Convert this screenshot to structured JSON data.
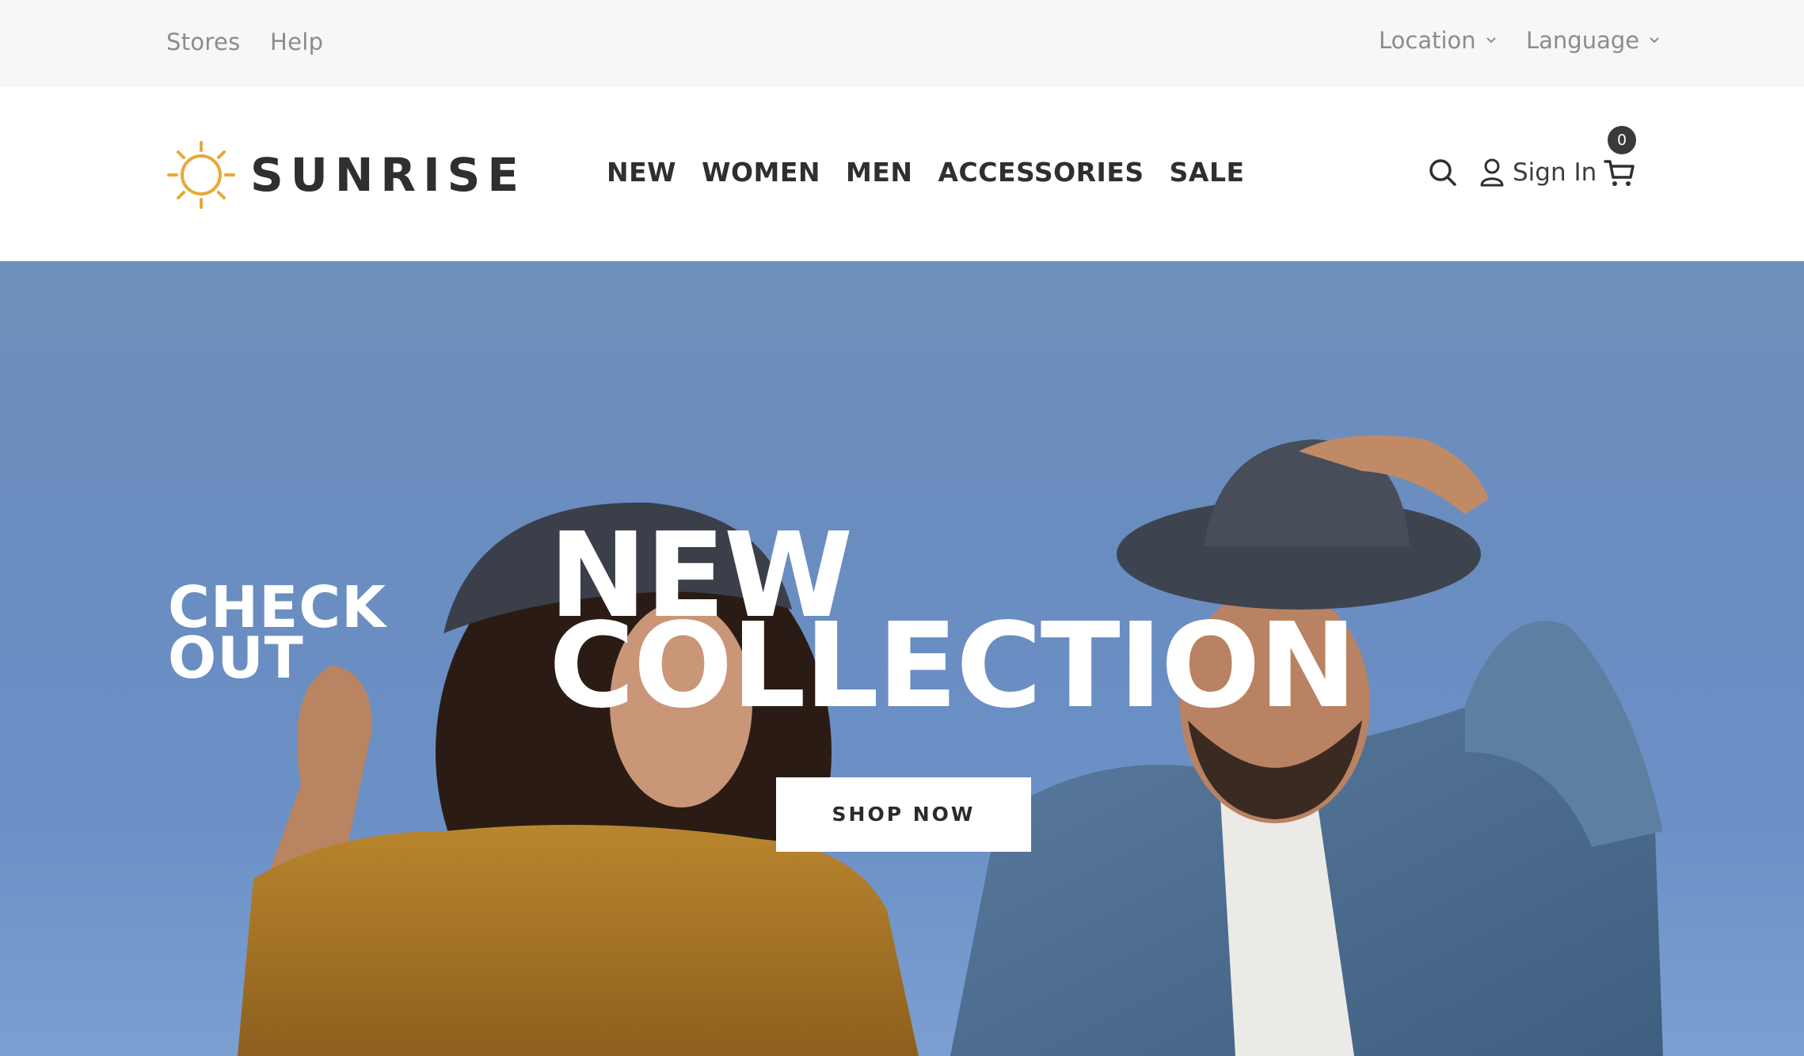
{
  "utility_bar": {
    "links": [
      "Stores",
      "Help"
    ],
    "location_label": "Location",
    "language_label": "Language"
  },
  "header": {
    "brand": "SUNRISE",
    "brand_color": "#e8a83a",
    "nav": [
      "NEW",
      "WOMEN",
      "MEN",
      "ACCESSORIES",
      "SALE"
    ],
    "sign_in_label": "Sign In",
    "cart_count": "0",
    "icons": [
      "search-icon",
      "user-icon",
      "cart-icon"
    ]
  },
  "hero": {
    "eyebrow_line1": "CHECK",
    "eyebrow_line2": "OUT",
    "headline_line1": "NEW",
    "headline_line2": "COLLECTION",
    "cta_label": "SHOP NOW"
  }
}
